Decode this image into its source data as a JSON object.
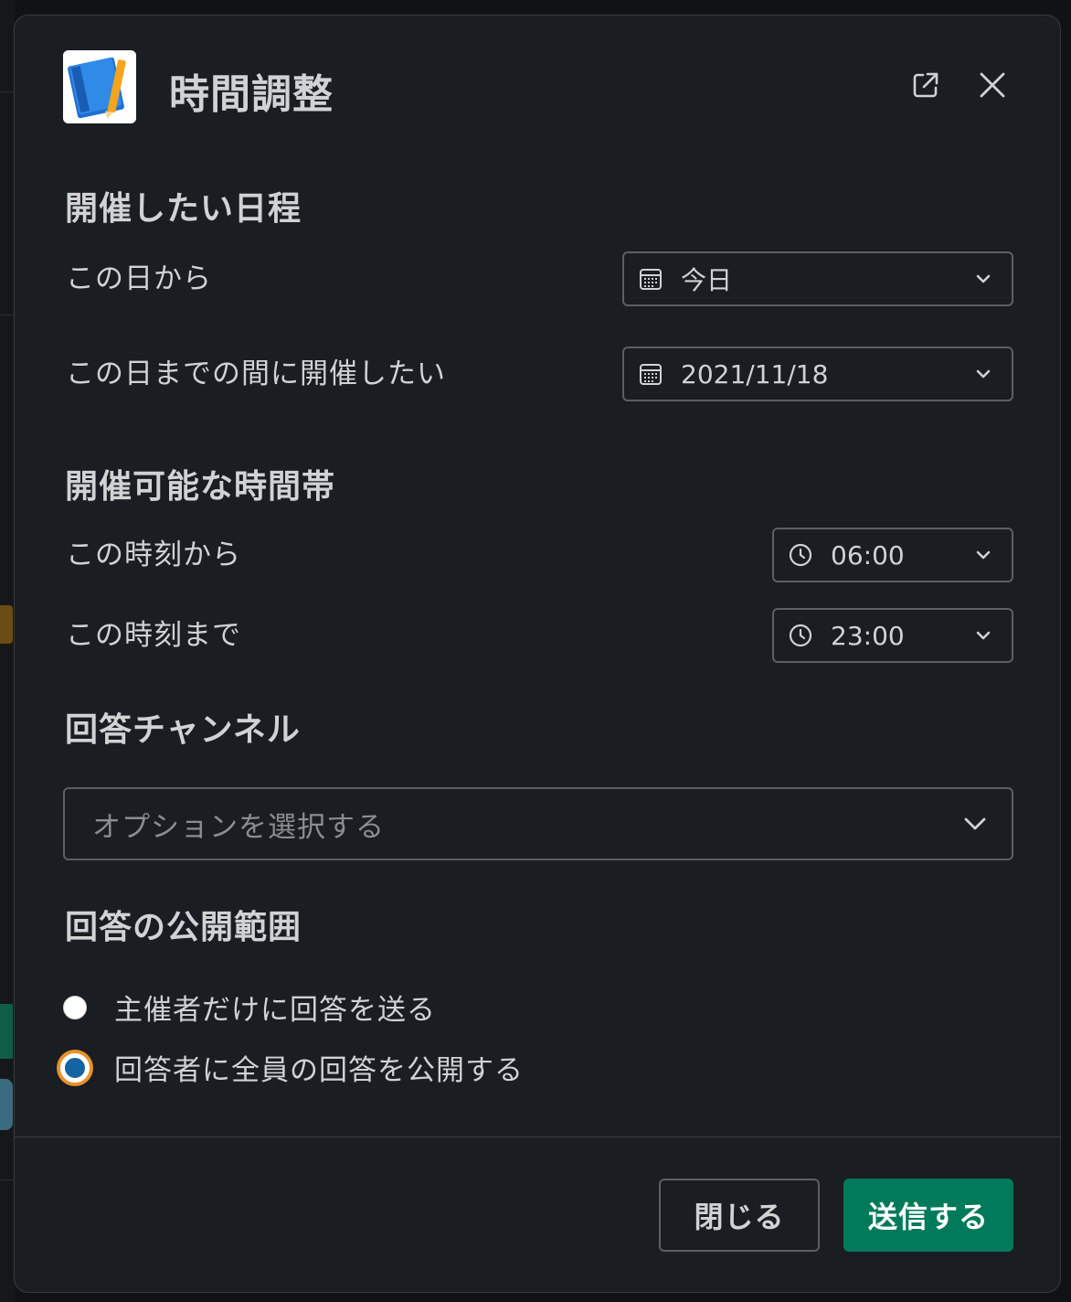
{
  "modal": {
    "title": "時間調整",
    "icons": {
      "app": "notebook-icon",
      "open_external": "external-link-icon",
      "close": "close-icon"
    }
  },
  "schedule": {
    "heading": "開催したい日程",
    "start": {
      "label": "この日から",
      "value": "今日",
      "icon": "calendar-icon"
    },
    "end": {
      "label": "この日までの間に開催したい",
      "value": "2021/11/18",
      "icon": "calendar-icon"
    }
  },
  "timeslot": {
    "heading": "開催可能な時間帯",
    "from": {
      "label": "この時刻から",
      "value": "06:00",
      "icon": "clock-icon"
    },
    "to": {
      "label": "この時刻まで",
      "value": "23:00",
      "icon": "clock-icon"
    }
  },
  "channel": {
    "heading": "回答チャンネル",
    "placeholder": "オプションを選択する"
  },
  "visibility": {
    "heading": "回答の公開範囲",
    "options": [
      {
        "label": "主催者だけに回答を送る",
        "selected": false
      },
      {
        "label": "回答者に全員の回答を公開する",
        "selected": true
      }
    ]
  },
  "footer": {
    "close_label": "閉じる",
    "submit_label": "送信する"
  },
  "colors": {
    "modal_bg": "#1a1d21",
    "submit_bg": "#007a5a",
    "radio_selected": "#1264a3",
    "focus_ring": "#e8912d"
  }
}
